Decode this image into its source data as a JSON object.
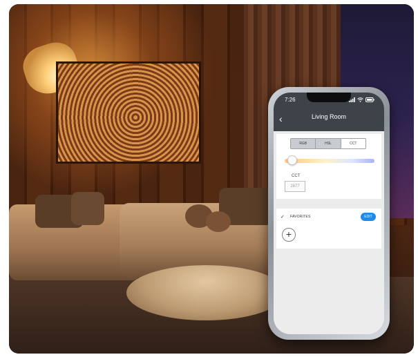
{
  "phone": {
    "status_time": "7:26",
    "screen_title": "Living Room",
    "mode_tabs": [
      "RGB",
      "HSL",
      "CCT"
    ],
    "active_tab": "CCT",
    "cct_label": "CCT",
    "cct_placeholder": "2877",
    "favorites_label": "FAVORITES",
    "edit_label": "EDIT",
    "add_symbol": "+"
  },
  "icons": {
    "back": "chevron-left-icon",
    "favorites_check": "check-icon",
    "signal": "signal-icon",
    "wifi": "wifi-icon",
    "battery": "battery-icon"
  },
  "colors": {
    "accent_blue": "#1e8be8",
    "topbar": "#3e434a"
  }
}
